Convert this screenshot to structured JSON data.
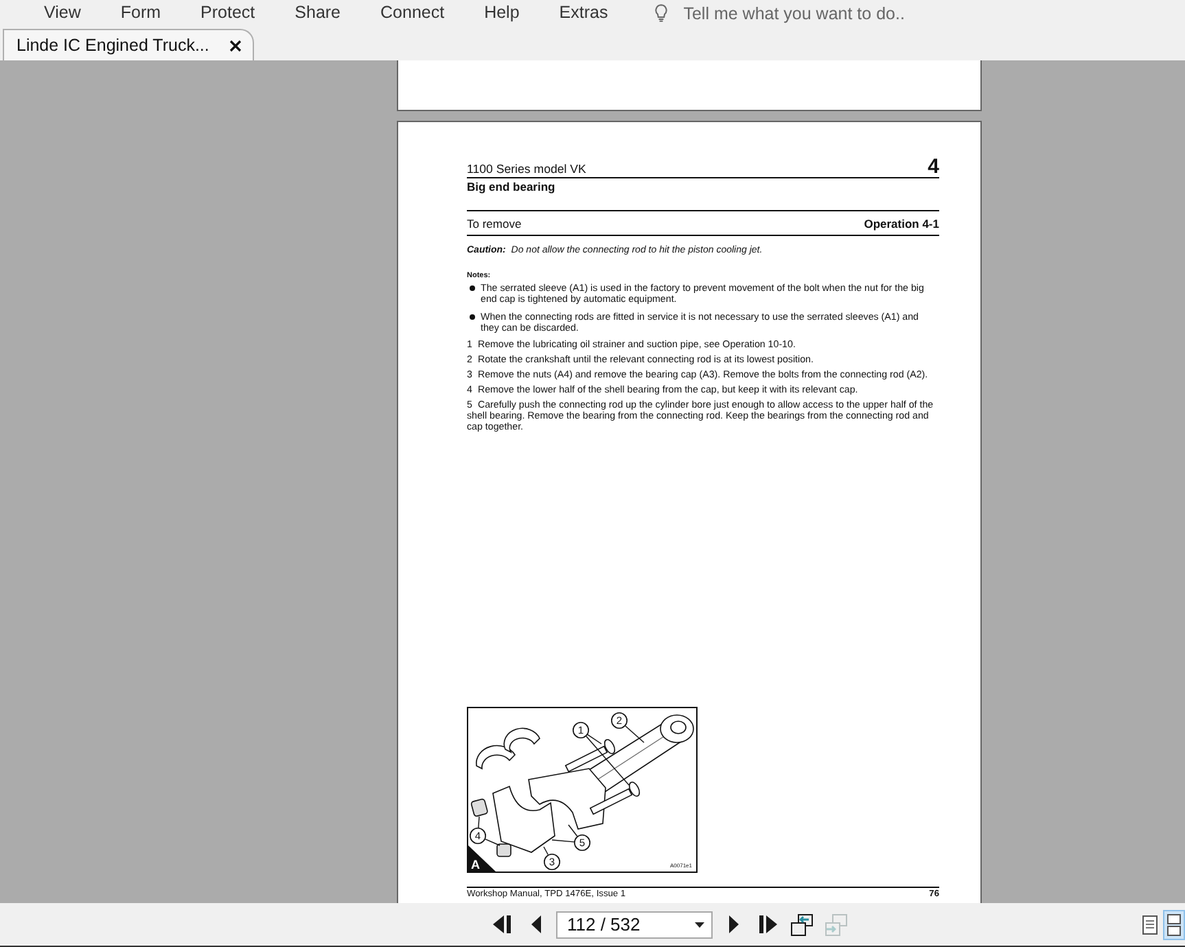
{
  "menu_bar": {
    "items": [
      "View",
      "Form",
      "Protect",
      "Share",
      "Connect",
      "Help",
      "Extras"
    ],
    "tell_me": {
      "placeholder": "Tell me what you want to do.."
    }
  },
  "tabs": [
    {
      "label": "Linde IC Engined Truck...",
      "selected": true
    }
  ],
  "page": {
    "header": {
      "series": "1100 Series model VK",
      "chapter": "4",
      "title": "Big end bearing"
    },
    "section": {
      "title": "To remove",
      "operation": "Operation 4-1"
    },
    "caution": "**Caution:**  Do not allow the connecting rod to hit the piston cooling jet.",
    "notes": {
      "heading": "Notes:",
      "items": [
        "The serrated sleeve (A1) is used in the factory to prevent movement of the bolt when the nut for the big end cap is tightened by automatic equipment.",
        "When the connecting rods are fitted in service it is not necessary to use the serrated sleeves (A1) and they can be discarded."
      ]
    },
    "steps": [
      {
        "number": "1",
        "text": "Remove the lubricating oil strainer and suction pipe, see Operation 10-10."
      },
      {
        "number": "2",
        "text": "Rotate the crankshaft until the relevant connecting rod is at its lowest position."
      },
      {
        "number": "3",
        "text": "Remove the nuts (A4) and remove the bearing cap (A3). Remove the bolts from the connecting rod (A2)."
      },
      {
        "number": "4",
        "text": "Remove the lower half of the shell bearing from the cap, but keep it with its relevant cap."
      },
      {
        "number": "5",
        "text": "Carefully push the connecting rod up the cylinder bore just enough to allow access to the upper half of the shell bearing. Remove the bearing from the connecting rod. Keep the bearings from the connecting rod and cap together."
      }
    ],
    "figure": {
      "label": "A",
      "code": "A0071e1",
      "callouts": [
        "1",
        "2",
        "3",
        "4",
        "5"
      ]
    },
    "footer": {
      "text": "Workshop Manual, TPD 1476E, Issue 1",
      "page_number": "76"
    }
  },
  "toolbar": {
    "items": [
      {
        "kind": "first",
        "disabled": false
      },
      {
        "kind": "previous",
        "disabled": false
      },
      {
        "kind": "page_field",
        "value": "112 / 532"
      },
      {
        "kind": "next",
        "disabled": false
      },
      {
        "kind": "last",
        "disabled": false
      },
      {
        "kind": "previous_view",
        "disabled": false
      },
      {
        "kind": "next_view",
        "disabled": true
      }
    ],
    "view_modes": [
      {
        "kind": "single_page",
        "selected": false
      },
      {
        "kind": "continuous",
        "selected": true
      }
    ]
  }
}
